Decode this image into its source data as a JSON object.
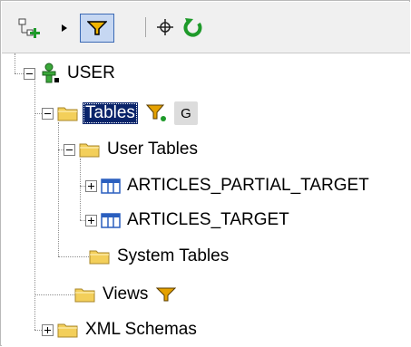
{
  "toolbar": {
    "buttons": [
      {
        "name": "add-node-button",
        "icon": "tree-add-icon"
      },
      {
        "name": "dropdown-arrow",
        "icon": "triangle-right-icon"
      },
      {
        "name": "filter-button",
        "icon": "filter-funnel-icon",
        "pressed": true
      },
      {
        "name": "locate-button",
        "icon": "crosshair-icon"
      },
      {
        "name": "refresh-button",
        "icon": "refresh-icon"
      }
    ]
  },
  "tree": {
    "root": {
      "label": "USER",
      "icon": "user-schema-icon"
    },
    "tables": {
      "label": "Tables",
      "badge": "G",
      "filter_icon": "filter-funnel-icon"
    },
    "user_tables": {
      "label": "User Tables"
    },
    "table_items": [
      {
        "label": "ARTICLES_PARTIAL_TARGET"
      },
      {
        "label": "ARTICLES_TARGET"
      }
    ],
    "system_tables": {
      "label": "System Tables"
    },
    "views": {
      "label": "Views"
    },
    "xml_schemas": {
      "label": "XML Schemas"
    }
  },
  "colors": {
    "selection": "#0a246a",
    "folder": "#f3cf5a",
    "filter": "#e5a100",
    "refresh": "#1e9a2a",
    "table_icon": "#2a5fbf"
  }
}
